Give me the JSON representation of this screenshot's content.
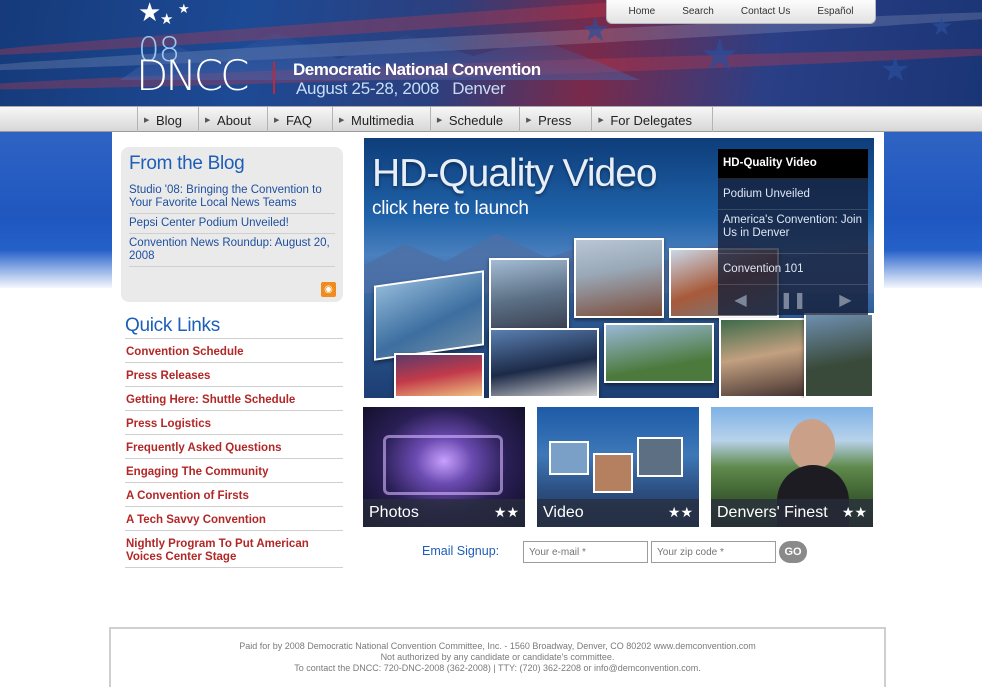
{
  "header": {
    "logo_top": "08",
    "logo_main": "DNCC",
    "title": "Democratic National Convention",
    "dates": "August 25-28, 2008   Denver"
  },
  "utility_nav": [
    "Home",
    "Search",
    "Contact Us",
    "Español"
  ],
  "main_nav": [
    "Blog",
    "About",
    "FAQ",
    "Multimedia",
    "Schedule",
    "Press",
    "For Delegates"
  ],
  "blog": {
    "title": "From the Blog",
    "items": [
      "Studio '08: Bringing the Convention to Your Favorite Local News Teams",
      "Pepsi Center Podium Unveiled!",
      "Convention News Roundup: August 20, 2008"
    ]
  },
  "quick_links": {
    "title": "Quick Links",
    "items": [
      "Convention Schedule",
      "Press Releases",
      "Getting Here: Shuttle Schedule",
      "Press Logistics",
      "Frequently Asked Questions",
      "Engaging The Community",
      "A Convention of Firsts",
      "A Tech Savvy Convention",
      "Nightly Program To Put American Voices Center Stage"
    ]
  },
  "hero": {
    "title": "HD-Quality Video",
    "subtitle": "click here to launch"
  },
  "playlist": {
    "items": [
      "HD-Quality Video",
      "Podium Unveiled",
      "America's Convention: Join Us in Denver",
      "Convention 101"
    ],
    "active_index": 0
  },
  "thumbnails": [
    "Photos",
    "Video",
    "Denvers' Finest"
  ],
  "signup": {
    "label": "Email Signup:",
    "email_placeholder": "Your e-mail *",
    "zip_placeholder": "Your zip code *",
    "go_label": "GO"
  },
  "footer": {
    "line1": "Paid for by 2008 Democratic National Convention Committee, Inc. - 1560 Broadway, Denver, CO 80202 www.demconvention.com",
    "line2": "Not authorized by any candidate or candidate's committee.",
    "line3": "To contact the DNCC: 720-DNC-2008 (362-2008) | TTY: (720) 362-2208 or info@demconvention.com."
  },
  "colors": {
    "brand_blue": "#1d5eb8",
    "link_red": "#b32727",
    "header_navy": "#163a7a"
  }
}
